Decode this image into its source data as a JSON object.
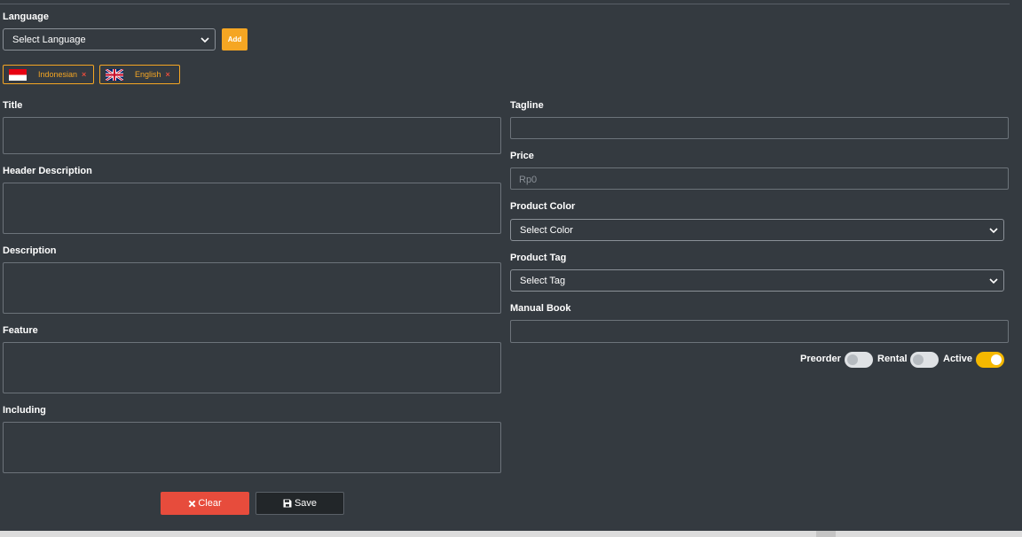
{
  "language": {
    "label": "Language",
    "select_value": "Select Language",
    "add_label": "Add",
    "chips": [
      {
        "name": "Indonesian",
        "remove": "×"
      },
      {
        "name": "English",
        "remove": "×"
      }
    ]
  },
  "left": {
    "title_label": "Title",
    "header_description_label": "Header Description",
    "description_label": "Description",
    "feature_label": "Feature",
    "including_label": "Including"
  },
  "right": {
    "tagline_label": "Tagline",
    "price_label": "Price",
    "price_placeholder": "Rp0",
    "product_color_label": "Product Color",
    "product_color_value": "Select Color",
    "product_tag_label": "Product Tag",
    "product_tag_value": "Select Tag",
    "manual_book_label": "Manual Book"
  },
  "toggles": {
    "preorder_label": "Preorder",
    "preorder_on": false,
    "rental_label": "Rental",
    "rental_on": false,
    "active_label": "Active",
    "active_on": true
  },
  "actions": {
    "clear_label": "Clear",
    "save_label": "Save"
  },
  "colors": {
    "background": "#343a40",
    "accent": "#f5a623",
    "danger": "#e74c3c",
    "toggle_on": "#f5b800"
  }
}
